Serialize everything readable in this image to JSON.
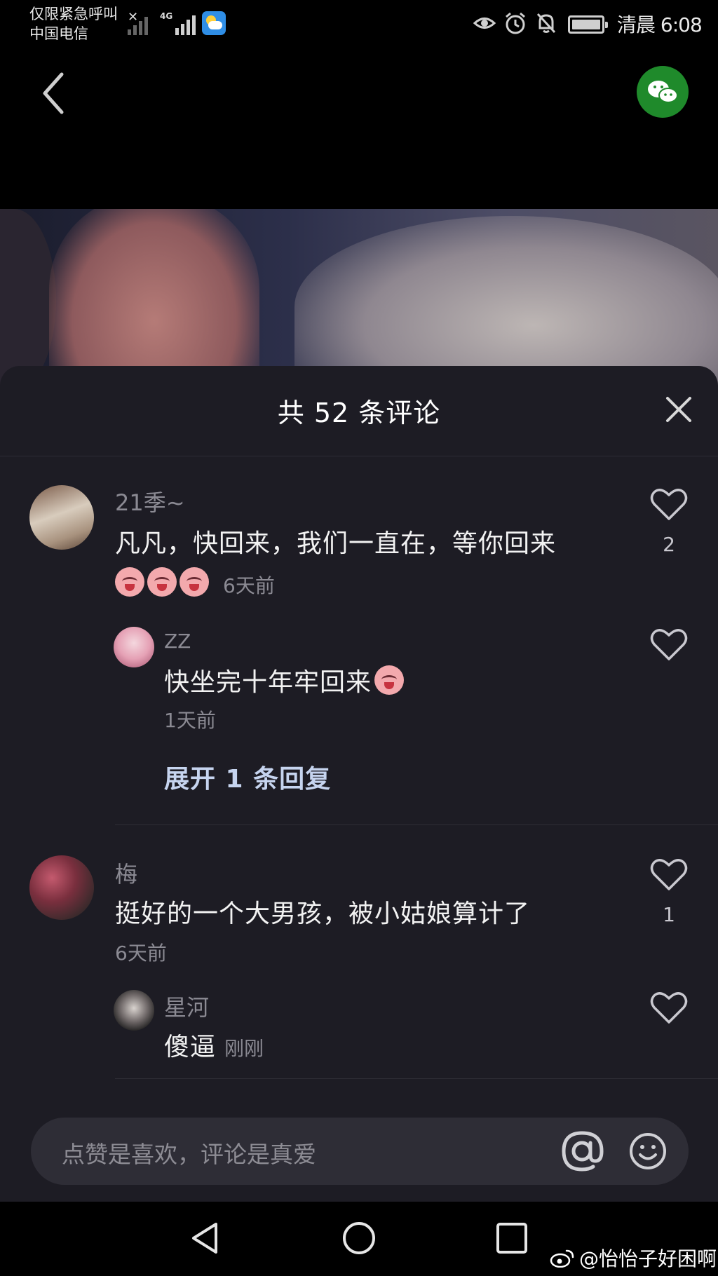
{
  "status_bar": {
    "carrier_line1": "仅限紧急呼叫",
    "carrier_line2": "中国电信",
    "network": "4G",
    "time": "清晨 6:08"
  },
  "comments_panel": {
    "title": "共 52 条评论",
    "comments": [
      {
        "username": "21季~",
        "text": "凡凡，快回来，我们一直在，等你回来",
        "time": "6天前",
        "likes": "2",
        "replies": [
          {
            "username": "ZZ",
            "text": "快坐完十年牢回来",
            "time": "1天前"
          }
        ],
        "expand_label": "展开 1 条回复"
      },
      {
        "username": "梅",
        "text": "挺好的一个大男孩，被小姑娘算计了",
        "time": "6天前",
        "likes": "1",
        "replies": [
          {
            "username": "星河",
            "text": "傻逼",
            "time": "刚刚"
          }
        ]
      }
    ]
  },
  "input_bar": {
    "placeholder": "点赞是喜欢，评论是真爱"
  },
  "watermark": "@怡怡子好困啊",
  "colors": {
    "panel_bg": "#1d1c24",
    "wechat_green": "#1f8a2b",
    "expand_link": "#c6d4ef"
  }
}
